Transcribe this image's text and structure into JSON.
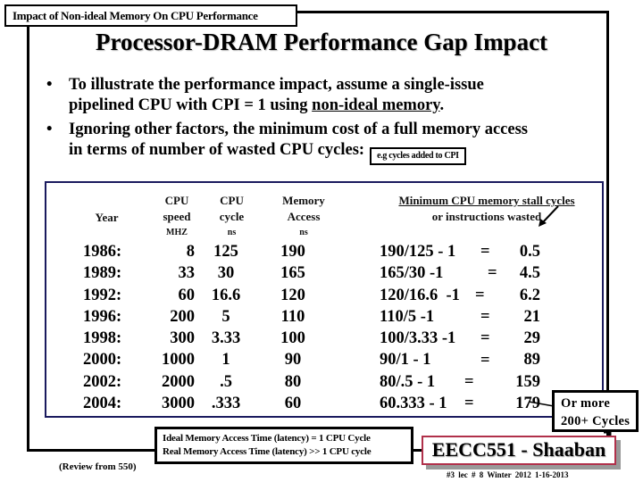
{
  "header": {
    "section_label": "Impact of Non-ideal Memory On CPU Performance",
    "title": "Processor-DRAM  Performance Gap Impact"
  },
  "bullets": [
    {
      "symbol": "•",
      "line1": "To  illustrate the performance impact, assume a single-issue",
      "line2_pre": "pipelined  CPU with CPI = 1  using ",
      "line2_underlined": "non-ideal memory",
      "line2_post": "."
    },
    {
      "symbol": "•",
      "line1": "Ignoring other factors, the minimum cost of a full memory access",
      "line2": "in terms of number of wasted CPU cycles:",
      "note": "e.g cycles added to CPI"
    }
  ],
  "table": {
    "headers": {
      "year": "Year",
      "cpu_speed": [
        "CPU",
        "speed",
        "MHZ"
      ],
      "cpu_cycle": [
        "CPU",
        "cycle",
        "ns"
      ],
      "memory_access": [
        "Memory",
        "Access",
        "ns"
      ],
      "stall_title": "Minimum CPU memory stall cycles",
      "stall_subtitle": "or instructions wasted"
    },
    "rows": [
      {
        "year": "1986:",
        "speed": "8",
        "cycle": "125",
        "mem": "190",
        "calc": "190/125 - 1",
        "eq": "=",
        "result": "0.5"
      },
      {
        "year": "1989:",
        "speed": "33",
        "cycle": "30",
        "mem": "165",
        "calc": "165/30 -1",
        "eq": "=",
        "result": "4.5"
      },
      {
        "year": "1992:",
        "speed": "60",
        "cycle": "16.6",
        "mem": "120",
        "calc": "120/16.6  -1",
        "eq": "=",
        "result": "6.2"
      },
      {
        "year": "1996:",
        "speed": "200",
        "cycle": "5",
        "mem": "110",
        "calc": "110/5 -1",
        "eq": "=",
        "result": "21"
      },
      {
        "year": "1998:",
        "speed": "300",
        "cycle": "3.33",
        "mem": "100",
        "calc": "100/3.33 -1",
        "eq": "=",
        "result": "29"
      },
      {
        "year": "2000:",
        "speed": "1000",
        "cycle": "1",
        "mem": "90",
        "calc": "90/1 - 1",
        "eq": "=",
        "result": "89"
      },
      {
        "year": "2002:",
        "speed": "2000",
        "cycle": ".5",
        "mem": "80",
        "calc": "80/.5 - 1",
        "eq": "=",
        "result": "159"
      },
      {
        "year": "2004:",
        "speed": "3000",
        "cycle": ".333",
        "mem": "60",
        "calc": "60.333 - 1",
        "eq": "=",
        "result": "179"
      }
    ]
  },
  "callouts": {
    "or_more_line1": "Or more",
    "or_more_line2": "200+ Cycles",
    "ideal_line": "Ideal Memory Access Time (latency) = 1 CPU Cycle",
    "real_line": "Real Memory Access Time (latency) >> 1 CPU cycle",
    "review": "(Review from 550)"
  },
  "footer": {
    "course": "EECC551 - Shaaban",
    "slide_info": "#3   lec # 8   Winter 2012  1-16-2013"
  },
  "colors": {
    "inner_box_border": "#1a1a5e",
    "course_box_border": "#b0304a"
  }
}
